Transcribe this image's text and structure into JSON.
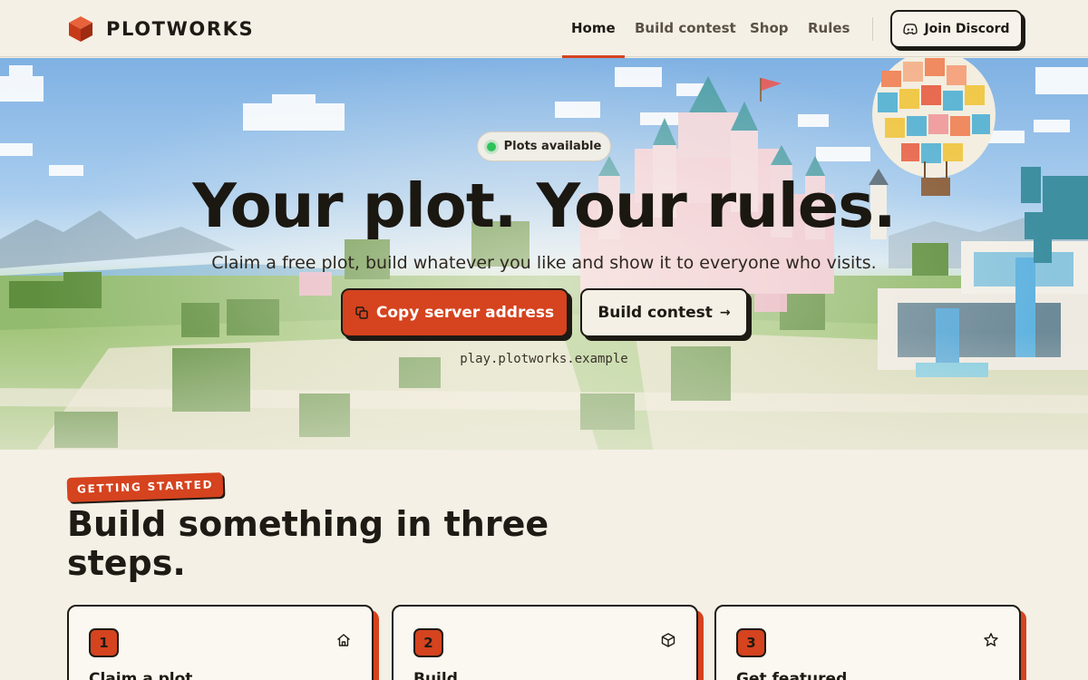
{
  "brand": {
    "name": "PLOTWORKS",
    "logo_icon": "red-cube-icon",
    "accent": "#d5431f"
  },
  "nav": {
    "links": [
      {
        "label": "Home",
        "active": true
      },
      {
        "label": "Build contest",
        "active": false
      },
      {
        "label": "Shop",
        "active": false
      },
      {
        "label": "Rules",
        "active": false
      }
    ],
    "discord_label": "Join Discord",
    "discord_icon": "discord-icon"
  },
  "hero": {
    "status_label": "Plots available",
    "status_color": "#2ec25a",
    "title": "Your plot. Your rules.",
    "subtitle": "Claim a free plot, build whatever you like and show it to everyone who visits.",
    "primary_label": "Copy server address",
    "primary_icon": "copy-icon",
    "secondary_label": "Build contest",
    "secondary_icon": "arrow-right-icon",
    "server_address": "play.plotworks.example"
  },
  "steps": {
    "eyebrow": "GETTING STARTED",
    "title": "Build something in three steps.",
    "cards": [
      {
        "number": "1",
        "title": "Claim a plot",
        "icon": "home-icon"
      },
      {
        "number": "2",
        "title": "Build",
        "icon": "cube-icon"
      },
      {
        "number": "3",
        "title": "Get featured",
        "icon": "star-icon"
      }
    ]
  }
}
